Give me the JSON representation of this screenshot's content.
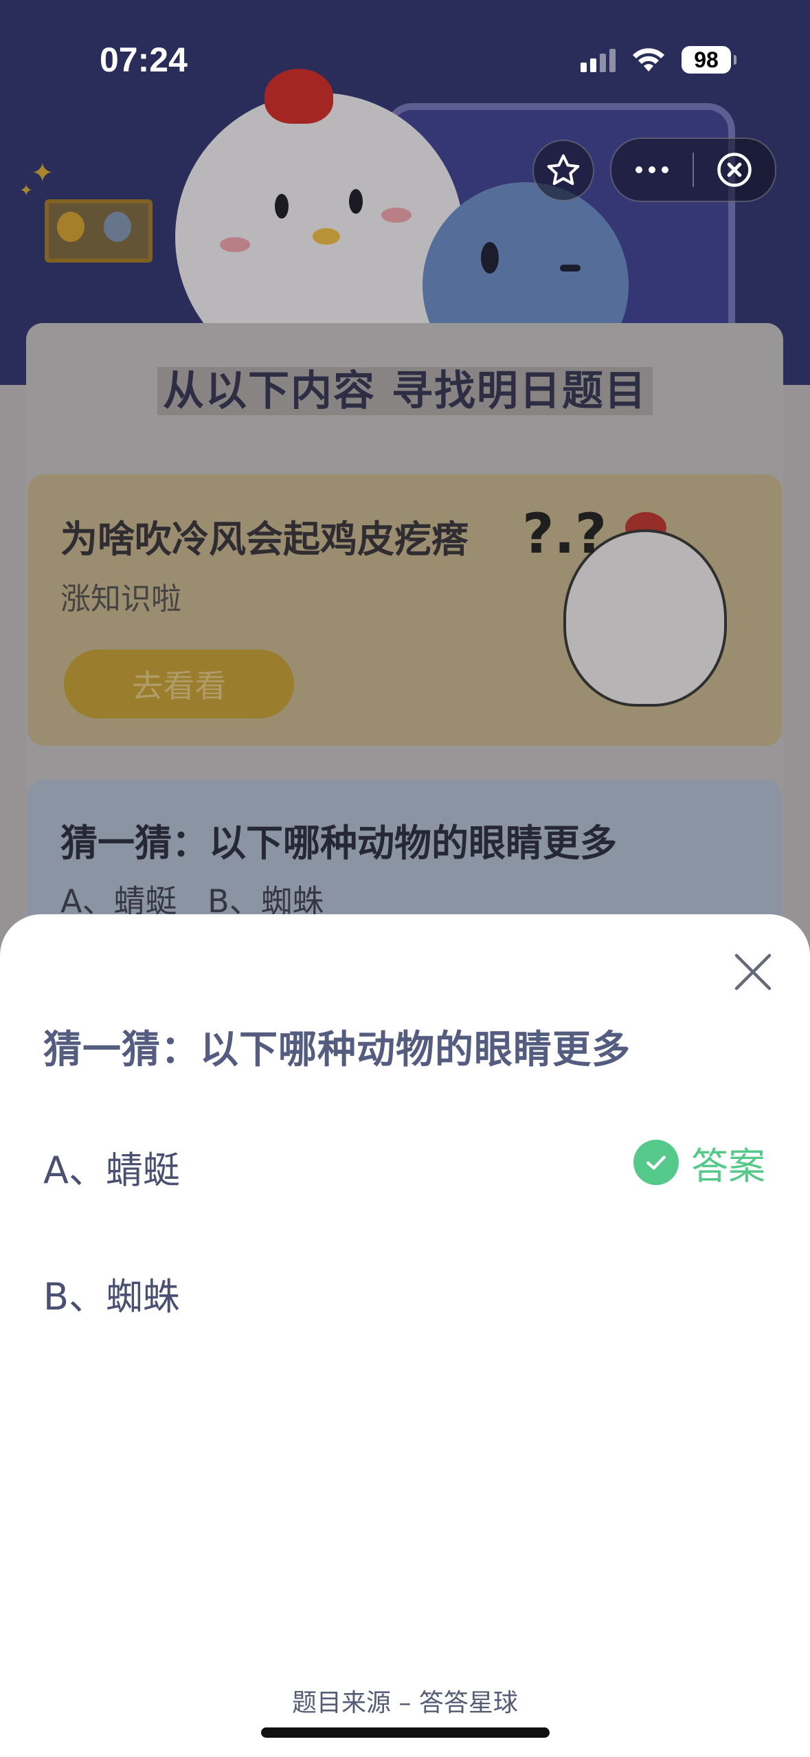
{
  "status_bar": {
    "time": "07:24",
    "battery": "98"
  },
  "header": {
    "star_icon": "star-icon",
    "more_icon": "more-dots-icon",
    "close_icon": "close-circle-icon"
  },
  "background": {
    "section_title": "从以下内容 寻找明日题目",
    "card": {
      "title": "为啥吹冷风会起鸡皮疙瘩",
      "subtitle": "涨知识啦",
      "button": "去看看"
    },
    "guess_card": {
      "title": "猜一猜：以下哪种动物的眼睛更多",
      "options": "A、蜻蜓  B、蜘蛛"
    }
  },
  "sheet": {
    "question": "猜一猜：以下哪种动物的眼睛更多",
    "options": [
      {
        "label": "A、蜻蜓",
        "is_answer": true
      },
      {
        "label": "B、蜘蛛",
        "is_answer": false
      }
    ],
    "answer_label": "答案",
    "source": "题目来源 – 答答星球"
  },
  "colors": {
    "accent_green": "#55c98a",
    "question_text": "#545c80"
  }
}
